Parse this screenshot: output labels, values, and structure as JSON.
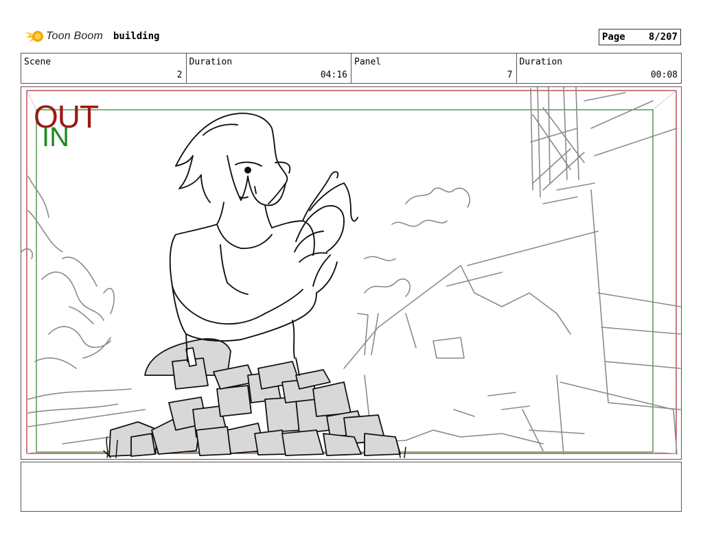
{
  "header": {
    "logo_text": "Toon Boom",
    "project_name": "building",
    "page_label": "Page",
    "page_value": "8/207"
  },
  "info": {
    "scene_label": "Scene",
    "scene_value": "2",
    "scene_duration_label": "Duration",
    "scene_duration_value": "04:16",
    "panel_label": "Panel",
    "panel_value": "7",
    "panel_duration_label": "Duration",
    "panel_duration_value": "00:08"
  },
  "panel": {
    "out_marker": "OUT",
    "in_marker": "IN",
    "colors": {
      "out_frame": "#b0202a",
      "in_frame": "#2a7a2a",
      "ink": "#111111",
      "bg_ink": "#888888",
      "rock_fill": "#d8d8d8"
    }
  },
  "notes": {
    "text": ""
  }
}
